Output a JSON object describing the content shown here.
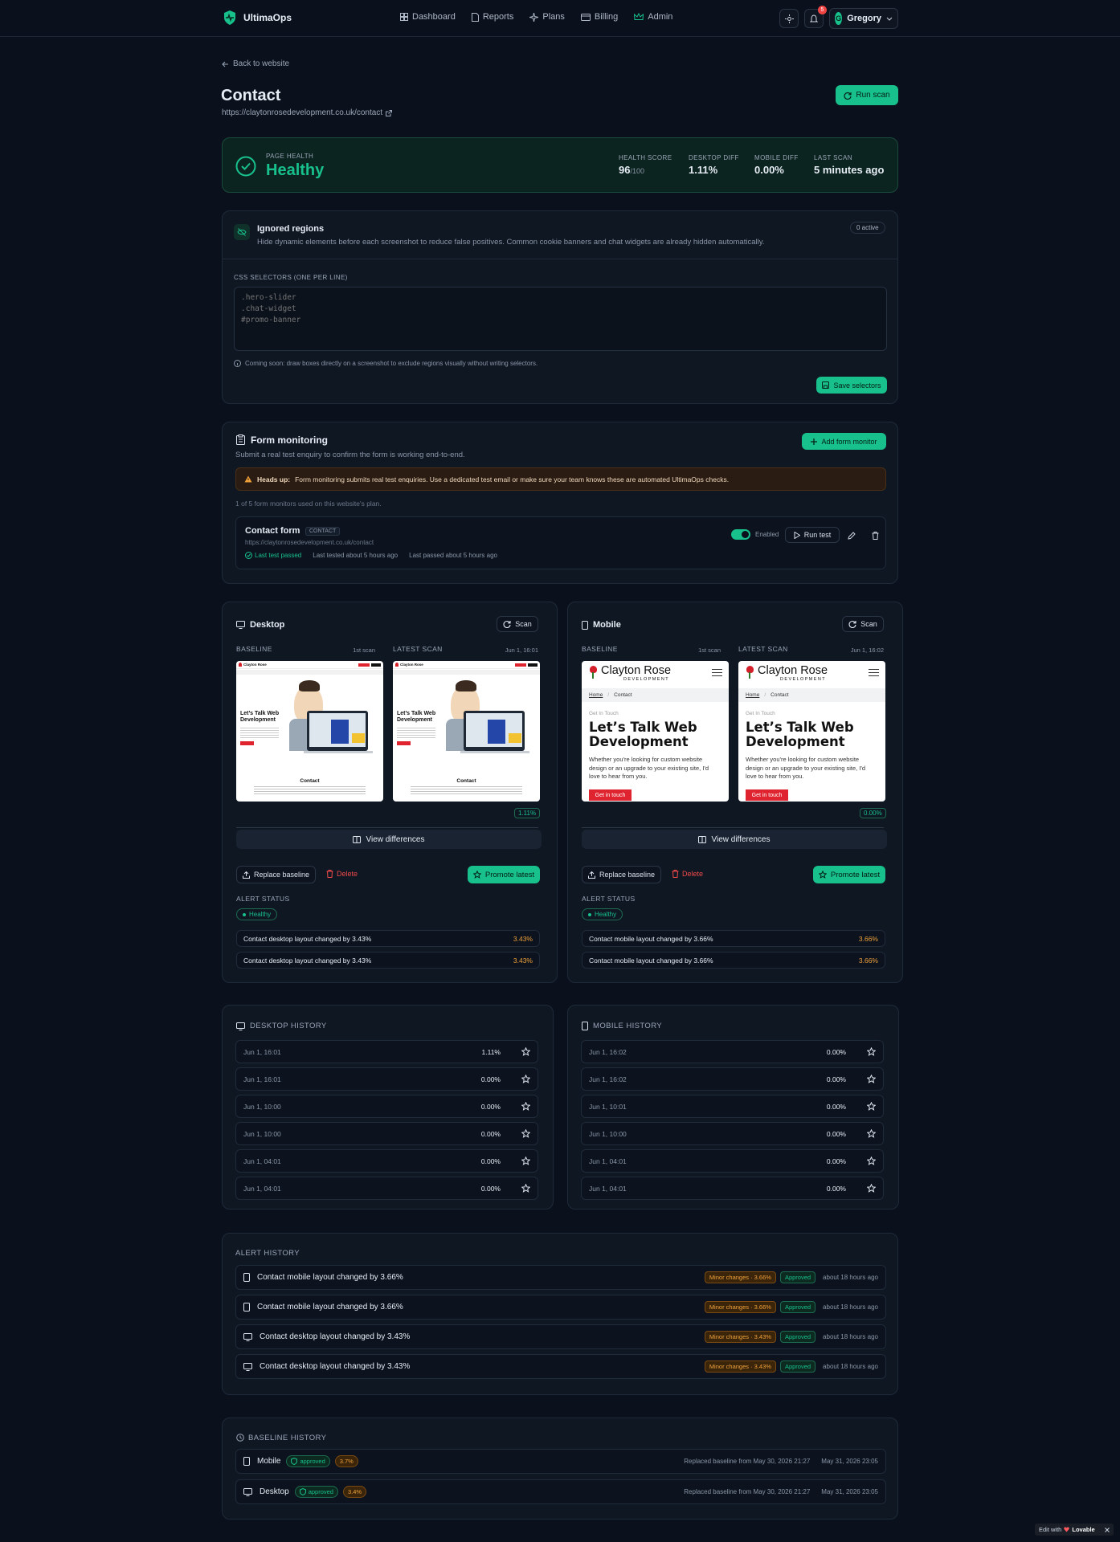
{
  "app": {
    "name": "UltimaOps"
  },
  "nav": {
    "items": [
      "Dashboard",
      "Reports",
      "Plans",
      "Billing",
      "Admin"
    ]
  },
  "header": {
    "notification_count": "5",
    "user_initial": "G",
    "user_name": "Gregory"
  },
  "page": {
    "back_label": "Back to website",
    "title": "Contact",
    "url": "https://claytonrosedevelopment.co.uk/contact",
    "run_scan": "Run scan"
  },
  "health": {
    "label": "PAGE HEALTH",
    "status": "Healthy",
    "score_label": "HEALTH SCORE",
    "score": "96",
    "score_max": "/100",
    "desktop_diff_label": "DESKTOP DIFF",
    "desktop_diff": "1.11%",
    "mobile_diff_label": "MOBILE DIFF",
    "mobile_diff": "0.00%",
    "last_scan_label": "LAST SCAN",
    "last_scan": "5 minutes ago"
  },
  "ignored": {
    "title": "Ignored regions",
    "description": "Hide dynamic elements before each screenshot to reduce false positives. Common cookie banners and chat widgets are already hidden automatically.",
    "badge": "0 active",
    "selectors_label": "CSS SELECTORS (ONE PER LINE)",
    "selectors_placeholder": ".hero-slider\n.chat-widget\n#promo-banner",
    "note": "Coming soon: draw boxes directly on a screenshot to exclude regions visually without writing selectors.",
    "save": "Save selectors"
  },
  "forms": {
    "title": "Form monitoring",
    "subtitle": "Submit a real test enquiry to confirm the form is working end-to-end.",
    "add": "Add form monitor",
    "warn_bold": "Heads up:",
    "warn_text": "Form monitoring submits real test enquiries. Use a dedicated test email or make sure your team knows these are automated UltimaOps checks.",
    "usage": "1 of 5 form monitors used on this website's plan.",
    "monitor": {
      "name": "Contact form",
      "tag": "CONTACT",
      "url": "https://claytonrosedevelopment.co.uk/contact",
      "status": "Last test passed",
      "last_tested": "Last tested about 5 hours ago",
      "last_passed": "Last passed about 5 hours ago",
      "toggle_label": "Enabled",
      "run_test": "Run test"
    }
  },
  "desktop": {
    "title": "Desktop",
    "scan": "Scan",
    "baseline_label": "BASELINE",
    "baseline_meta": "1st scan",
    "latest_label": "LATEST SCAN",
    "latest_meta": "Jun 1, 16:01",
    "diff": "1.11%",
    "view_diff": "View differences",
    "replace": "Replace baseline",
    "delete": "Delete",
    "promote": "Promote latest",
    "alert_status_label": "ALERT STATUS",
    "alert_status": "Healthy",
    "alerts": [
      {
        "text": "Contact desktop layout changed by 3.43%",
        "value": "3.43%"
      },
      {
        "text": "Contact desktop layout changed by 3.43%",
        "value": "3.43%"
      }
    ]
  },
  "mobile": {
    "title": "Mobile",
    "scan": "Scan",
    "baseline_label": "BASELINE",
    "baseline_meta": "1st scan",
    "latest_label": "LATEST SCAN",
    "latest_meta": "Jun 1, 16:02",
    "diff": "0.00%",
    "view_diff": "View differences",
    "replace": "Replace baseline",
    "delete": "Delete",
    "promote": "Promote latest",
    "alert_status_label": "ALERT STATUS",
    "alert_status": "Healthy",
    "alerts": [
      {
        "text": "Contact mobile layout changed by 3.66%",
        "value": "3.66%"
      },
      {
        "text": "Contact mobile layout changed by 3.66%",
        "value": "3.66%"
      }
    ]
  },
  "shot": {
    "brand": "Clayton Rose",
    "brand_sub": "DEVELOPMENT",
    "crumb_home": "Home",
    "crumb_page": "Contact",
    "eyebrow": "Get In Touch",
    "heading": "Let’s Talk Web Development",
    "body": "Whether you're looking for custom website design or an upgrade to your existing site, I'd love to hear from you.",
    "cta": "Get in touch",
    "section": "Contact"
  },
  "desktop_history": {
    "title": "DESKTOP HISTORY",
    "rows": [
      {
        "date": "Jun 1, 16:01",
        "value": "1.11%"
      },
      {
        "date": "Jun 1, 16:01",
        "value": "0.00%"
      },
      {
        "date": "Jun 1, 10:00",
        "value": "0.00%"
      },
      {
        "date": "Jun 1, 10:00",
        "value": "0.00%"
      },
      {
        "date": "Jun 1, 04:01",
        "value": "0.00%"
      },
      {
        "date": "Jun 1, 04:01",
        "value": "0.00%"
      }
    ]
  },
  "mobile_history": {
    "title": "MOBILE HISTORY",
    "rows": [
      {
        "date": "Jun 1, 16:02",
        "value": "0.00%"
      },
      {
        "date": "Jun 1, 16:02",
        "value": "0.00%"
      },
      {
        "date": "Jun 1, 10:01",
        "value": "0.00%"
      },
      {
        "date": "Jun 1, 10:00",
        "value": "0.00%"
      },
      {
        "date": "Jun 1, 04:01",
        "value": "0.00%"
      },
      {
        "date": "Jun 1, 04:01",
        "value": "0.00%"
      }
    ]
  },
  "alert_history": {
    "title": "ALERT HISTORY",
    "rows": [
      {
        "device": "mobile",
        "text": "Contact mobile layout changed by 3.66%",
        "tag": "Minor changes · 3.66%",
        "status": "Approved",
        "time": "about 18 hours ago"
      },
      {
        "device": "mobile",
        "text": "Contact mobile layout changed by 3.66%",
        "tag": "Minor changes · 3.66%",
        "status": "Approved",
        "time": "about 18 hours ago"
      },
      {
        "device": "desktop",
        "text": "Contact desktop layout changed by 3.43%",
        "tag": "Minor changes · 3.43%",
        "status": "Approved",
        "time": "about 18 hours ago"
      },
      {
        "device": "desktop",
        "text": "Contact desktop layout changed by 3.43%",
        "tag": "Minor changes · 3.43%",
        "status": "Approved",
        "time": "about 18 hours ago"
      }
    ]
  },
  "baseline_history": {
    "title": "BASELINE HISTORY",
    "rows": [
      {
        "device": "Mobile",
        "status": "approved",
        "value": "3.7%",
        "replaced": "Replaced baseline from May 30, 2026 21:27",
        "date": "May 31, 2026 23:05"
      },
      {
        "device": "Desktop",
        "status": "approved",
        "value": "3.4%",
        "replaced": "Replaced baseline from May 30, 2026 21:27",
        "date": "May 31, 2026 23:05"
      }
    ]
  },
  "footer": {
    "edit_with": "Edit with",
    "brand": "Lovable"
  },
  "colors": {
    "accent": "#18c08c",
    "background": "#0b111c",
    "card": "#0f1723",
    "warning": "#f0a13a",
    "danger": "#f04a4a"
  }
}
